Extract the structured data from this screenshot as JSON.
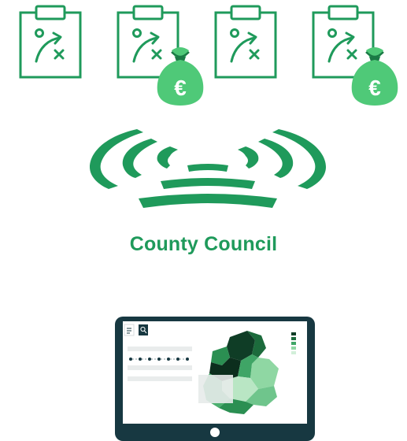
{
  "colors": {
    "brand_green": "#1f9a5b",
    "light_green": "#5ccf7e",
    "tablet_frame": "#173841"
  },
  "icons": {
    "clipboard": "clipboard-strategy-icon",
    "money_bag": "euro-money-bag-icon",
    "broadcast": "broadcast-signal-icon",
    "tablet": "tablet-map-dashboard-icon"
  },
  "money_bag_symbol": "€",
  "heading": "County Council"
}
